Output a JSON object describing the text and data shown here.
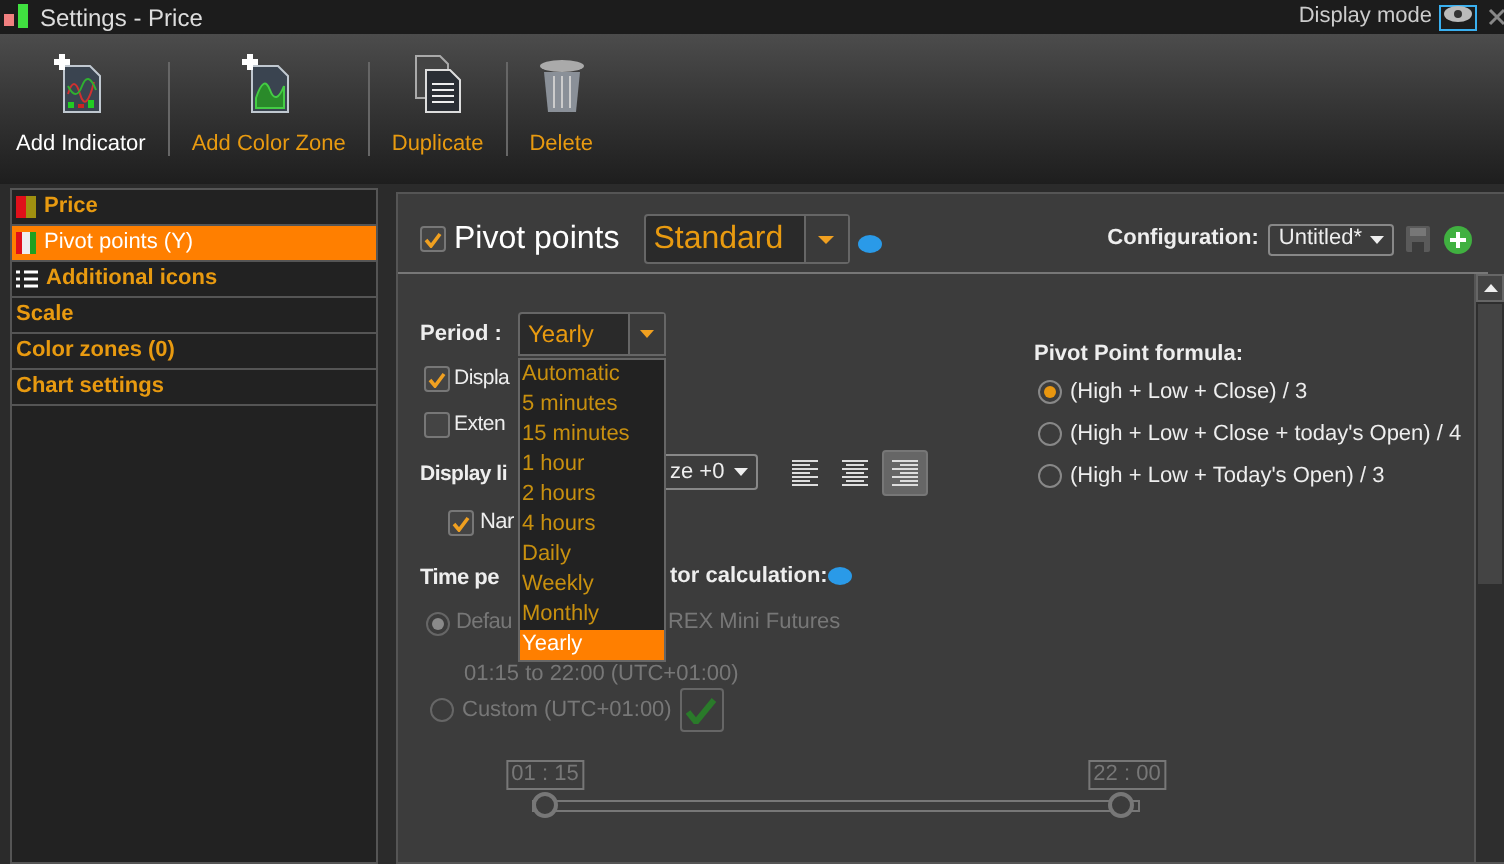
{
  "window": {
    "title": "Settings - Price",
    "display_mode": "Display mode"
  },
  "toolbar": [
    {
      "label": "Add Indicator",
      "kind": "indicator",
      "active": true
    },
    {
      "label": "Add Color Zone",
      "kind": "zone",
      "active": false
    },
    {
      "label": "Duplicate",
      "kind": "duplicate",
      "active": false
    },
    {
      "label": "Delete",
      "kind": "delete",
      "active": false
    }
  ],
  "sidebar": {
    "items": [
      {
        "label": "Price",
        "kind": "price",
        "selected": false
      },
      {
        "label": "Pivot points (Y)",
        "kind": "pivot",
        "selected": true
      },
      {
        "label": "Additional icons",
        "kind": "list",
        "selected": false
      },
      {
        "label": "Scale",
        "kind": "plain",
        "selected": false
      },
      {
        "label": "Color zones (0)",
        "kind": "plain",
        "selected": false
      },
      {
        "label": "Chart settings",
        "kind": "plain",
        "selected": false
      }
    ]
  },
  "header": {
    "enabled": true,
    "title": "Pivot points",
    "style": "Standard",
    "config_label": "Configuration:",
    "config_value": "Untitled*"
  },
  "period": {
    "label": "Period :",
    "value": "Yearly",
    "expanded": true,
    "options": [
      {
        "label": "Automatic",
        "selected": false
      },
      {
        "label": "5 minutes",
        "selected": false
      },
      {
        "label": "15 minutes",
        "selected": false
      },
      {
        "label": "1 hour",
        "selected": false
      },
      {
        "label": "2 hours",
        "selected": false
      },
      {
        "label": "4 hours",
        "selected": false
      },
      {
        "label": "Daily",
        "selected": false
      },
      {
        "label": "Weekly",
        "selected": false
      },
      {
        "label": "Monthly",
        "selected": false
      },
      {
        "label": "Yearly",
        "selected": true
      }
    ]
  },
  "display_checks": [
    {
      "label": "Displa",
      "checked": true
    },
    {
      "label": "Exten",
      "checked": false
    }
  ],
  "display_lines": {
    "label": "Display li",
    "font_size": "ze +0",
    "alignments": [
      {
        "kind": "left",
        "selected": false
      },
      {
        "kind": "center",
        "selected": false
      },
      {
        "kind": "right",
        "selected": true
      }
    ]
  },
  "names_check": {
    "label": "Nar",
    "checked": true
  },
  "time_period": {
    "label_start": "Time pe",
    "label_end": "tor calculation:",
    "options": [
      {
        "kind": "default",
        "label": "Defau",
        "label_end": "REX Mini Futures",
        "detail": "01:15 to 22:00 (UTC+01:00)",
        "selected": true
      },
      {
        "kind": "custom",
        "label": "Custom (UTC+01:00)",
        "selected": false
      }
    ]
  },
  "range": {
    "thumbs": [
      {
        "label": "01 : 15",
        "level": 0
      },
      {
        "label": "22 : 00",
        "level": 1
      }
    ]
  },
  "formula": {
    "title": "Pivot Point formula:",
    "options": [
      {
        "label": "(High + Low + Close) / 3",
        "selected": true
      },
      {
        "label": "(High + Low + Close + today's Open) / 4",
        "selected": false
      },
      {
        "label": "(High + Low + Today's Open) / 3",
        "selected": false
      }
    ]
  }
}
